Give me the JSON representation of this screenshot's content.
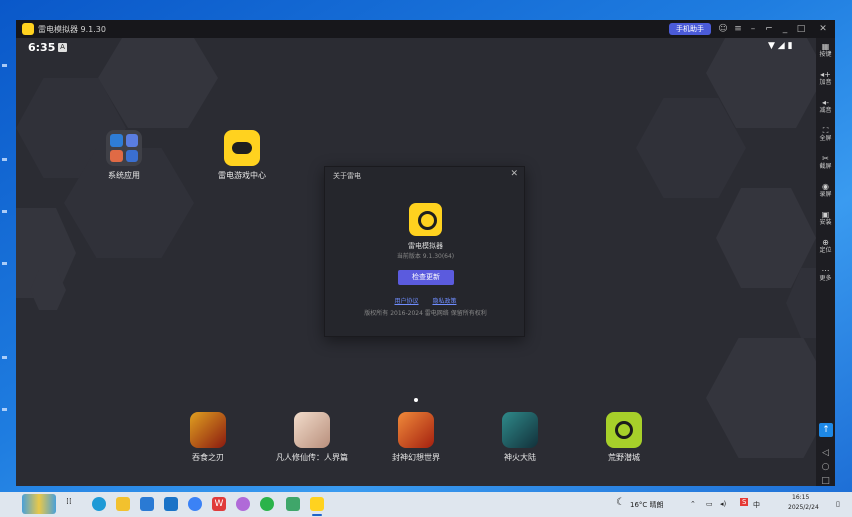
{
  "window": {
    "title": "雷电模拟器 9.1.30",
    "assistant_label": "手机助手"
  },
  "status_bar": {
    "time": "6:35"
  },
  "desktop_apps": [
    {
      "label": "系统应用"
    },
    {
      "label": "雷电游戏中心"
    }
  ],
  "dock_apps": [
    {
      "label": "吞食之刃",
      "color": "#b3301e"
    },
    {
      "label": "凡人修仙传：人界篇",
      "color": "#d9b9a8"
    },
    {
      "label": "封神幻想世界",
      "color": "#c2411f"
    },
    {
      "label": "神火大陆",
      "color": "#1f5a6a"
    },
    {
      "label": "荒野潜城",
      "color": "#a7d02a"
    }
  ],
  "dialog": {
    "title": "关于雷电",
    "app_name": "雷电模拟器",
    "version": "当前版本 9.1.30(64)",
    "button": "检查更新",
    "link_1": "用户协议",
    "link_2": "隐私政策",
    "footer": "版权所有 2016-2024 雷电网络 保留所有权利"
  },
  "sidebar": [
    {
      "icon": "keyboard-icon",
      "label": "按键"
    },
    {
      "icon": "volume-up-icon",
      "label": "加音"
    },
    {
      "icon": "volume-down-icon",
      "label": "减音"
    },
    {
      "icon": "fullscreen-icon",
      "label": "全屏"
    },
    {
      "icon": "scissors-icon",
      "label": "截屏"
    },
    {
      "icon": "record-icon",
      "label": "录屏"
    },
    {
      "icon": "install-icon",
      "label": "安装"
    },
    {
      "icon": "location-icon",
      "label": "定位"
    },
    {
      "icon": "more-icon",
      "label": "更多"
    }
  ],
  "taskbar": {
    "weather": "16°C 晴朗",
    "clock_time": "16:15",
    "clock_date": "2025/2/24",
    "ime_label": "中"
  },
  "colors": {
    "accent": "#5b5bde",
    "brand_yellow": "#ffd21f",
    "screen_bg": "#2b2c33"
  }
}
